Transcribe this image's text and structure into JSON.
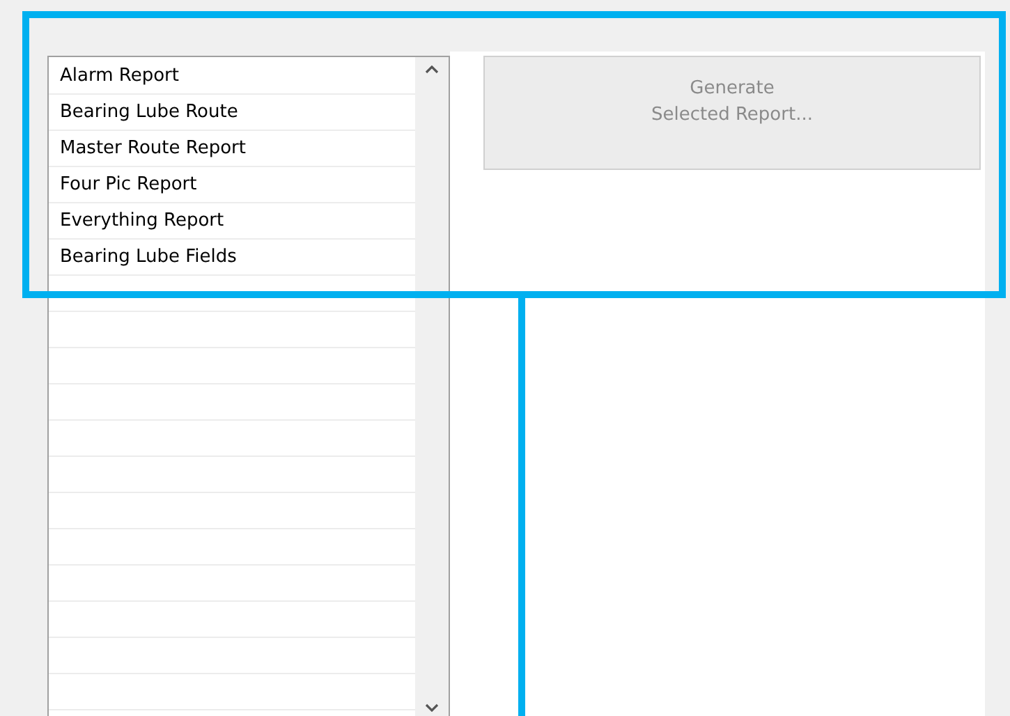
{
  "report_list": {
    "items": [
      {
        "label": "Alarm Report",
        "selected": false
      },
      {
        "label": "Bearing Lube Route",
        "selected": false
      },
      {
        "label": "Master Route Report",
        "selected": false
      },
      {
        "label": "Four Pic Report",
        "selected": false
      },
      {
        "label": "Everything Report",
        "selected": false
      },
      {
        "label": "Bearing Lube Fields",
        "selected": false
      }
    ]
  },
  "generate_button": {
    "label": "Generate\nSelected Report...",
    "disabled": true
  }
}
